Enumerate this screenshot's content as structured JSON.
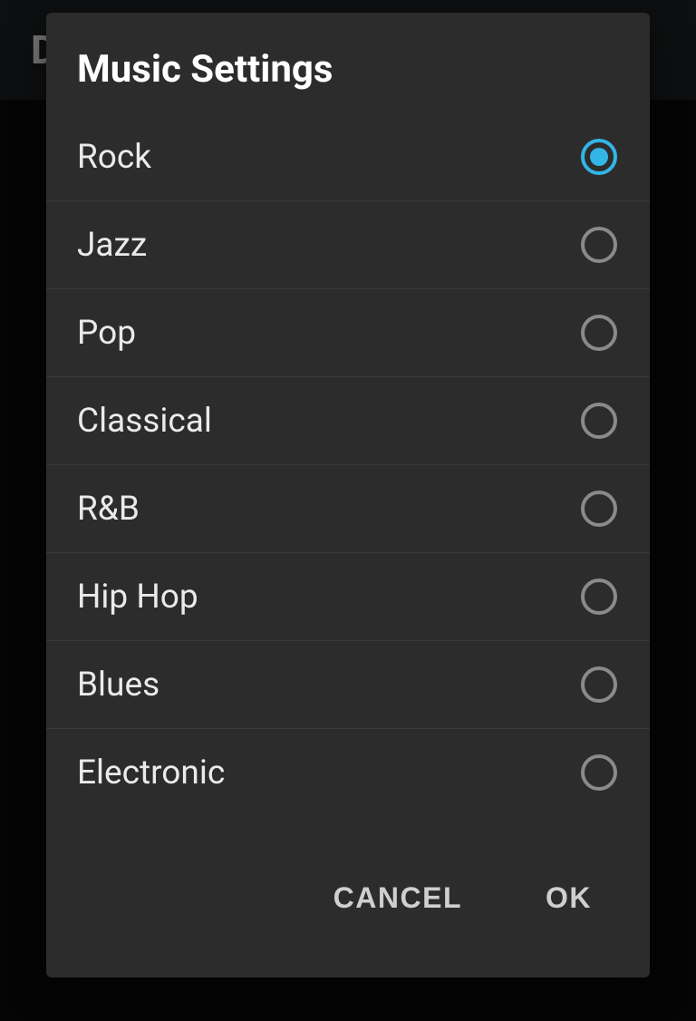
{
  "app": {
    "header_title_fragment": "D"
  },
  "dialog": {
    "title": "Music Settings",
    "options": [
      {
        "label": "Rock",
        "selected": true
      },
      {
        "label": "Jazz",
        "selected": false
      },
      {
        "label": "Pop",
        "selected": false
      },
      {
        "label": "Classical",
        "selected": false
      },
      {
        "label": "R&B",
        "selected": false
      },
      {
        "label": "Hip Hop",
        "selected": false
      },
      {
        "label": "Blues",
        "selected": false
      },
      {
        "label": "Electronic",
        "selected": false
      }
    ],
    "actions": {
      "cancel": "CANCEL",
      "ok": "OK"
    }
  },
  "colors": {
    "accent": "#33b5e5",
    "dialog_bg": "#2c2c2c",
    "divider": "#3a3a3a"
  }
}
